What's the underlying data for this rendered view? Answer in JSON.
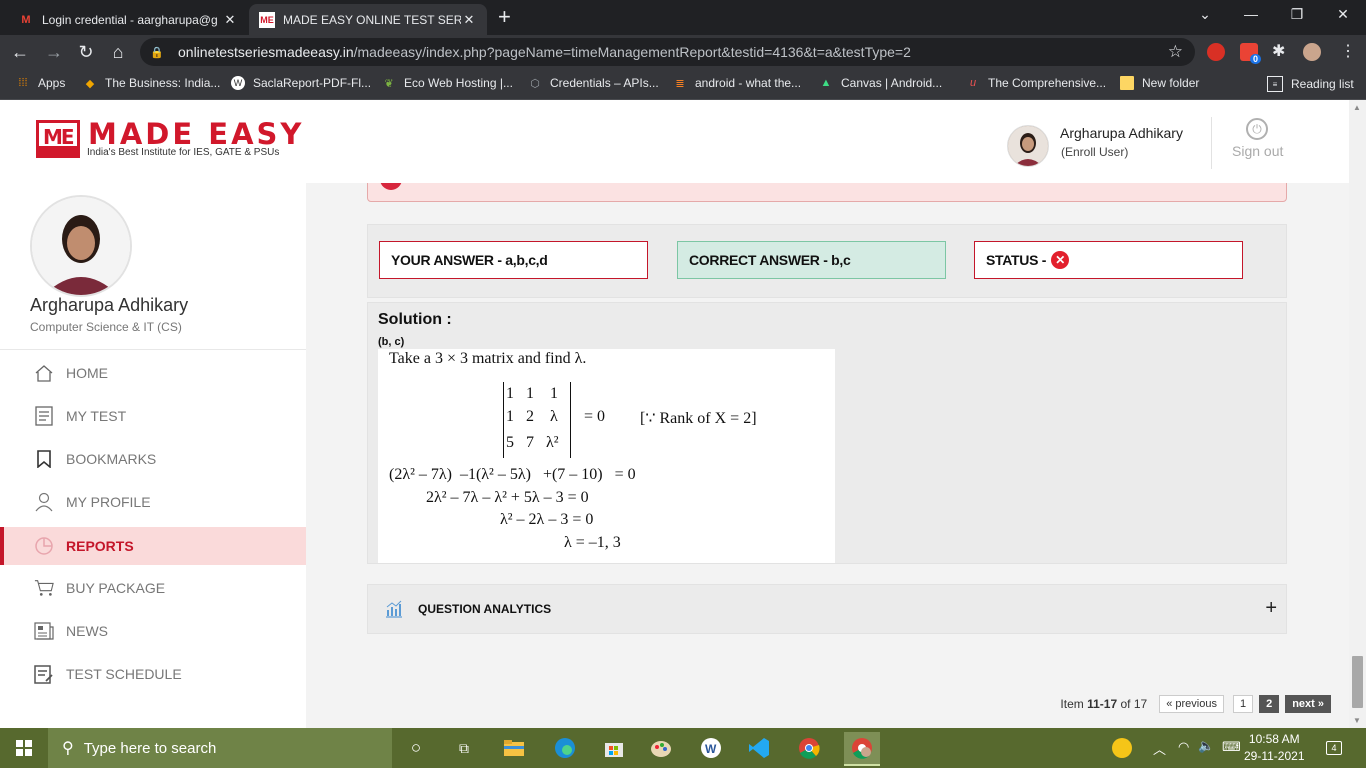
{
  "browser": {
    "tabs": [
      {
        "title": "Login credential - aargharupa@g",
        "icon": "gmail-icon"
      },
      {
        "title": "MADE EASY ONLINE TEST SERIES",
        "icon": "madeeasy-icon"
      }
    ],
    "url_host": "onlinetestseriesmadeeasy.in",
    "url_path": "/madeeasy/index.php?pageName=timeManagementReport&testid=4136&t=a&testType=2",
    "bookmarks": [
      {
        "label": "Apps"
      },
      {
        "label": "The Business: India..."
      },
      {
        "label": "SaclaReport-PDF-Fl..."
      },
      {
        "label": "Eco Web Hosting |..."
      },
      {
        "label": "Credentials – APIs..."
      },
      {
        "label": "android - what the..."
      },
      {
        "label": "Canvas | Android..."
      },
      {
        "label": "The Comprehensive..."
      },
      {
        "label": "New folder"
      }
    ],
    "reading_list": "Reading list",
    "extension_badge": "0"
  },
  "header": {
    "logo_word": "MADE EASY",
    "logo_tagline": "India's Best Institute for IES, GATE & PSUs",
    "user_name": "Argharupa Adhikary",
    "user_role": "(Enroll User)",
    "signout_label": "Sign out"
  },
  "sidebar": {
    "user_name": "Argharupa Adhikary",
    "branch": "Computer Science & IT (CS)",
    "items": [
      {
        "label": "HOME",
        "icon": "home-icon"
      },
      {
        "label": "MY TEST",
        "icon": "test-icon"
      },
      {
        "label": "BOOKMARKS",
        "icon": "bookmark-icon"
      },
      {
        "label": "MY PROFILE",
        "icon": "profile-icon"
      },
      {
        "label": "REPORTS",
        "icon": "reports-icon",
        "active": true
      },
      {
        "label": "BUY PACKAGE",
        "icon": "cart-icon"
      },
      {
        "label": "NEWS",
        "icon": "news-icon"
      },
      {
        "label": "TEST SCHEDULE",
        "icon": "schedule-icon"
      }
    ]
  },
  "result": {
    "your_answer": "YOUR ANSWER - a,b,c,d",
    "correct_answer": "CORRECT ANSWER - b,c",
    "status_label": "STATUS -",
    "status_symbol": "✕"
  },
  "solution": {
    "title": "Solution :",
    "answer": "(b, c)",
    "lines": {
      "intro": "Take a 3 × 3 matrix and find λ.",
      "row1": "1   1    1",
      "row2": "1   2    λ",
      "row3": "5   7   λ²",
      "eq_zero": "=  0",
      "reason": "[∵  Rank of X = 2]",
      "step1": "(2λ² – 7λ)  –1(λ² – 5λ)   +(7 – 10)   = 0",
      "step2": "2λ² – 7λ – λ² + 5λ – 3  =  0",
      "step3": "λ² – 2λ – 3  =  0",
      "step4": "λ  =  –1, 3"
    }
  },
  "analytics": {
    "label": "QUESTION ANALYTICS",
    "expand": "+"
  },
  "pagination": {
    "prefix": "Item",
    "range": "11-17",
    "of": "of",
    "total": "17",
    "previous": "« previous",
    "pages": [
      "1",
      "2"
    ],
    "current": "2",
    "next": "next »"
  },
  "taskbar": {
    "search_placeholder": "Type here to search",
    "time": "10:58 AM",
    "date": "29-11-2021",
    "notifications": "4"
  },
  "colors": {
    "brand_red": "#d1182b",
    "active_bg": "#fadada",
    "correct_bg": "#d4ebe3",
    "taskbar": "#57692e"
  }
}
